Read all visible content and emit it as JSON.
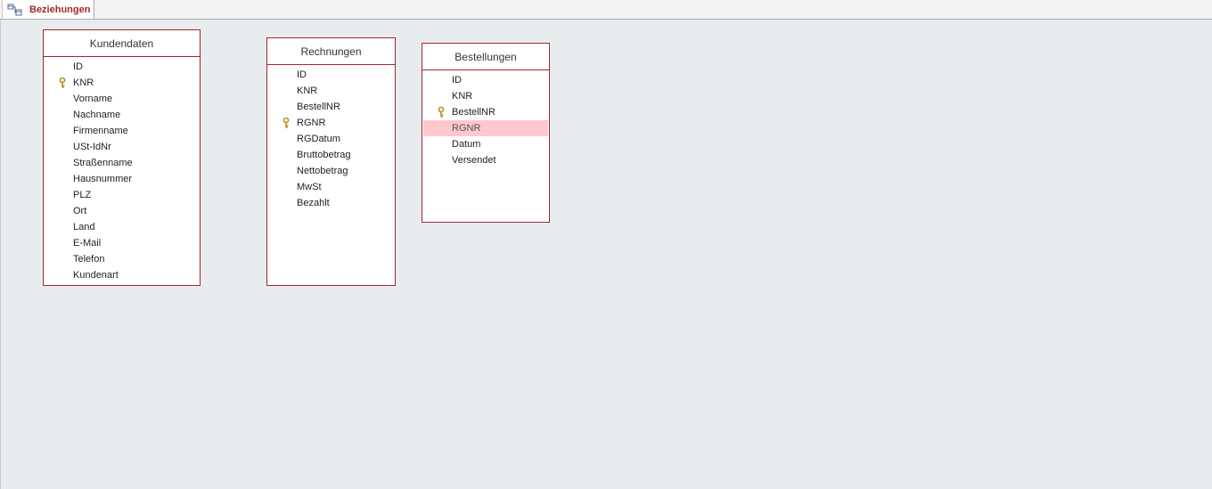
{
  "tab": {
    "label": "Beziehungen",
    "icon": "relationships-icon"
  },
  "tables": [
    {
      "title": "Kundendaten",
      "fields": [
        {
          "name": "ID",
          "key": false,
          "selected": false
        },
        {
          "name": "KNR",
          "key": true,
          "selected": false
        },
        {
          "name": "Vorname",
          "key": false,
          "selected": false
        },
        {
          "name": "Nachname",
          "key": false,
          "selected": false
        },
        {
          "name": "Firmenname",
          "key": false,
          "selected": false
        },
        {
          "name": "USt-IdNr",
          "key": false,
          "selected": false
        },
        {
          "name": "Straßenname",
          "key": false,
          "selected": false
        },
        {
          "name": "Hausnummer",
          "key": false,
          "selected": false
        },
        {
          "name": "PLZ",
          "key": false,
          "selected": false
        },
        {
          "name": "Ort",
          "key": false,
          "selected": false
        },
        {
          "name": "Land",
          "key": false,
          "selected": false
        },
        {
          "name": "E-Mail",
          "key": false,
          "selected": false
        },
        {
          "name": "Telefon",
          "key": false,
          "selected": false
        },
        {
          "name": "Kundenart",
          "key": false,
          "selected": false
        }
      ]
    },
    {
      "title": "Rechnungen",
      "fields": [
        {
          "name": "ID",
          "key": false,
          "selected": false
        },
        {
          "name": "KNR",
          "key": false,
          "selected": false
        },
        {
          "name": "BestellNR",
          "key": false,
          "selected": false
        },
        {
          "name": "RGNR",
          "key": true,
          "selected": false
        },
        {
          "name": "RGDatum",
          "key": false,
          "selected": false
        },
        {
          "name": "Bruttobetrag",
          "key": false,
          "selected": false
        },
        {
          "name": "Nettobetrag",
          "key": false,
          "selected": false
        },
        {
          "name": "MwSt",
          "key": false,
          "selected": false
        },
        {
          "name": "Bezahlt",
          "key": false,
          "selected": false
        }
      ]
    },
    {
      "title": "Bestellungen",
      "fields": [
        {
          "name": "ID",
          "key": false,
          "selected": false
        },
        {
          "name": "KNR",
          "key": false,
          "selected": false
        },
        {
          "name": "BestellNR",
          "key": true,
          "selected": false
        },
        {
          "name": "RGNR",
          "key": false,
          "selected": true
        },
        {
          "name": "Datum",
          "key": false,
          "selected": false
        },
        {
          "name": "Versendet",
          "key": false,
          "selected": false
        }
      ]
    }
  ],
  "colors": {
    "accent": "#a4262c",
    "selection": "#ffc7ce",
    "key": "#c9a227"
  }
}
